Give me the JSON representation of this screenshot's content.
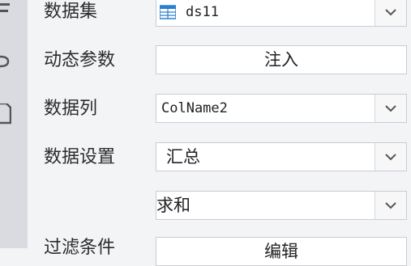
{
  "form": {
    "dataset": {
      "label": "数据集",
      "value": "ds11",
      "icon": "dataset-table-icon"
    },
    "dynamic_params": {
      "label": "动态参数",
      "button_label": "注入"
    },
    "data_column": {
      "label": "数据列",
      "value": "ColName2"
    },
    "data_setting": {
      "label": "数据设置",
      "value": "汇总"
    },
    "aggregate": {
      "value": "求和"
    },
    "filter_condition": {
      "label": "过滤条件",
      "button_label": "编辑"
    }
  },
  "left_rail": {
    "icons": [
      "structure-icon",
      "link-icon",
      "document-icon"
    ]
  }
}
